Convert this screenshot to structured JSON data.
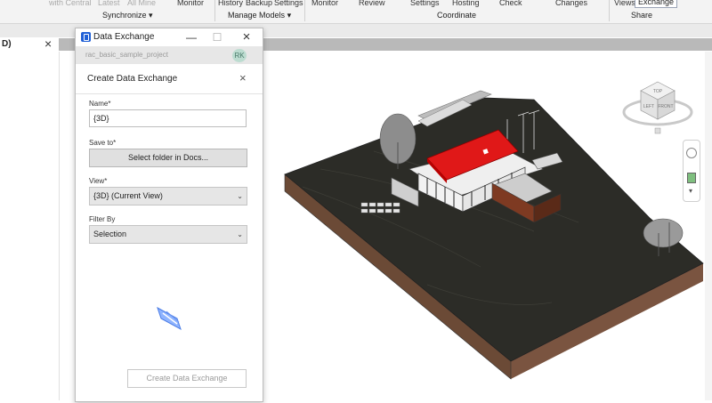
{
  "ribbon": {
    "top_labels": [
      "with Central",
      "Latest",
      "All Mine",
      "Monitor",
      "History",
      "Backup",
      "Settings",
      "Monitor",
      "Review",
      "Settings",
      "Hosting",
      "Check",
      "Changes",
      "Views",
      "Exchange"
    ],
    "panels": [
      "Synchronize",
      "Manage Models",
      "Coordinate",
      "Share"
    ]
  },
  "view_tab": {
    "label": "D)",
    "close": "×"
  },
  "dialog": {
    "window_title": "Data Exchange",
    "minimize": "—",
    "maximize": "☐",
    "close": "×",
    "project": "rac_basic_sample_project",
    "avatar": "RK",
    "header": "Create Data Exchange",
    "header_close": "×",
    "name_label": "Name*",
    "name_value": "{3D}",
    "save_label": "Save to*",
    "save_button": "Select folder in Docs...",
    "view_label": "View*",
    "view_value": "{3D} (Current View)",
    "filter_label": "Filter By",
    "filter_value": "Selection",
    "create_button": "Create Data Exchange"
  },
  "viewcube": {
    "front": "FRONT",
    "left": "LEFT",
    "top": "TOP"
  },
  "colors": {
    "terrain_top": "#2c2c27",
    "terrain_side": "#6b4a36",
    "roof": "#e01818",
    "accent": "#1f5fd6"
  }
}
